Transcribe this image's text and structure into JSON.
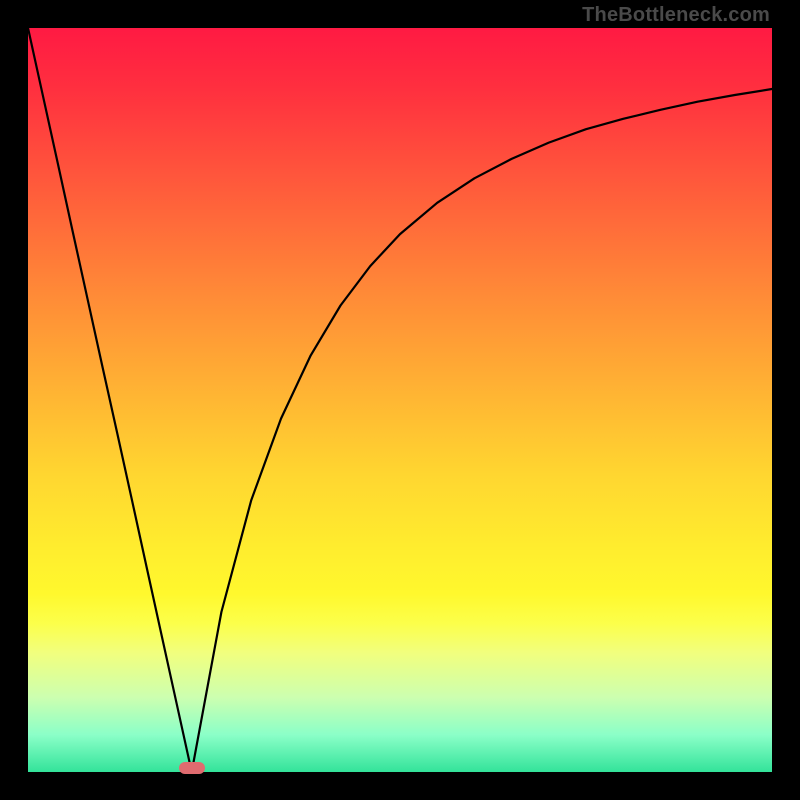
{
  "watermark": "TheBottleneck.com",
  "colors": {
    "gradient_top": "#ff1a43",
    "gradient_bottom": "#33e39a",
    "curve": "#000000",
    "marker_fill": "#e06b6f",
    "frame_bg": "#000000"
  },
  "chart_data": {
    "type": "line",
    "title": "",
    "xlabel": "",
    "ylabel": "",
    "xlim": [
      0,
      1
    ],
    "ylim": [
      0,
      1
    ],
    "annotations": [],
    "marker": {
      "x_fraction": 0.22,
      "y_fraction": 0.995
    },
    "series": [
      {
        "name": "left-branch",
        "x": [
          0.0,
          0.02,
          0.04,
          0.06,
          0.08,
          0.1,
          0.12,
          0.14,
          0.16,
          0.18,
          0.2,
          0.22
        ],
        "y": [
          1.0,
          0.909,
          0.818,
          0.727,
          0.636,
          0.545,
          0.455,
          0.364,
          0.273,
          0.182,
          0.091,
          0.0
        ]
      },
      {
        "name": "right-branch",
        "x": [
          0.22,
          0.26,
          0.3,
          0.34,
          0.38,
          0.42,
          0.46,
          0.5,
          0.55,
          0.6,
          0.65,
          0.7,
          0.75,
          0.8,
          0.85,
          0.9,
          0.95,
          1.0
        ],
        "y": [
          0.0,
          0.215,
          0.365,
          0.475,
          0.56,
          0.627,
          0.68,
          0.723,
          0.765,
          0.798,
          0.824,
          0.846,
          0.864,
          0.878,
          0.89,
          0.901,
          0.91,
          0.918
        ]
      }
    ]
  }
}
